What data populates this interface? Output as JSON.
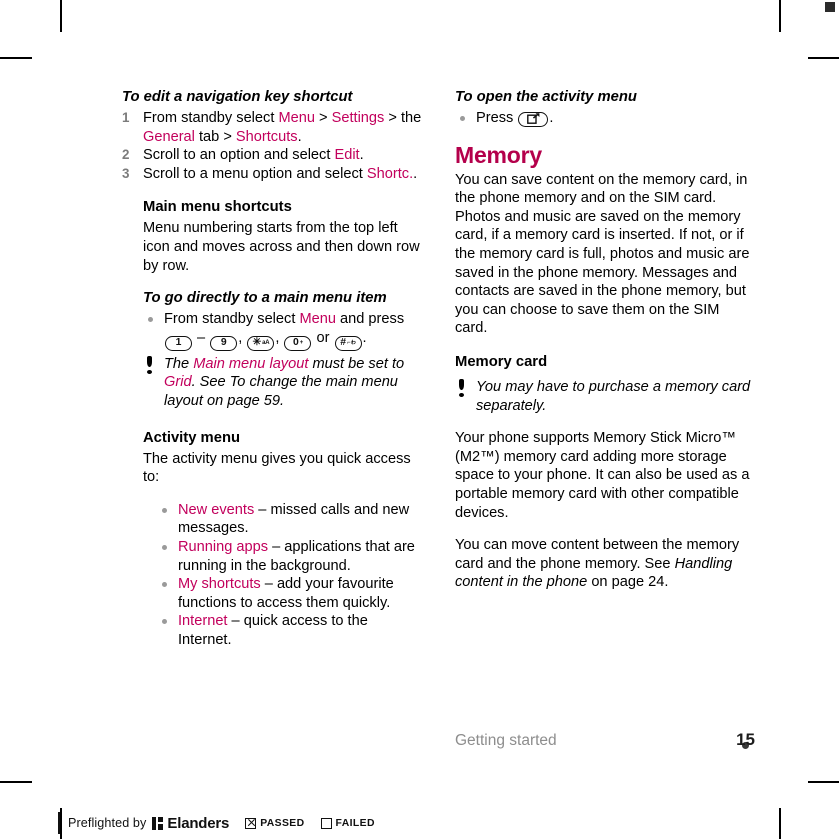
{
  "document": {
    "footer_section": "Getting started",
    "page_number": "15",
    "accent_color": "#c2005c",
    "heading_color": "#b4004b"
  },
  "left_column": {
    "procedure_1": {
      "heading": "To edit a navigation key shortcut",
      "steps": [
        {
          "parts": [
            {
              "t": "From standby select ",
              "s": "plain"
            },
            {
              "t": "Menu",
              "s": "ref"
            },
            {
              "t": " > ",
              "s": "plain"
            },
            {
              "t": "Settings",
              "s": "ref"
            },
            {
              "t": " > the ",
              "s": "plain"
            },
            {
              "t": "General",
              "s": "ref"
            },
            {
              "t": " tab > ",
              "s": "plain"
            },
            {
              "t": "Shortcuts",
              "s": "ref"
            },
            {
              "t": ".",
              "s": "plain"
            }
          ]
        },
        {
          "parts": [
            {
              "t": "Scroll to an option and select ",
              "s": "plain"
            },
            {
              "t": "Edit",
              "s": "ref"
            },
            {
              "t": ".",
              "s": "plain"
            }
          ]
        },
        {
          "parts": [
            {
              "t": "Scroll to a menu option and select ",
              "s": "plain"
            },
            {
              "t": "Shortc.",
              "s": "ref"
            },
            {
              "t": ".",
              "s": "plain"
            }
          ]
        }
      ]
    },
    "main_menu_shortcuts": {
      "heading": "Main menu shortcuts",
      "body": "Menu numbering starts from the top left icon and moves across and then down row by row."
    },
    "procedure_2": {
      "heading": "To go directly to a main menu item",
      "bullet_prefix": "From standby select ",
      "bullet_ref": "Menu",
      "bullet_mid": " and press ",
      "keys": [
        {
          "label": "1",
          "sup": ""
        },
        {
          "label": "9",
          "sup": ""
        },
        {
          "label": "✳",
          "sup": "aA"
        },
        {
          "label": "0",
          "sup": "+"
        },
        {
          "label": "#",
          "sup": "⌐ゎ"
        }
      ],
      "dash": " – ",
      "comma": ", ",
      "or": " or ",
      "period": "."
    },
    "note_1": {
      "parts": [
        {
          "t": "The ",
          "s": "ital"
        },
        {
          "t": "Main menu layout",
          "s": "refi"
        },
        {
          "t": " must be set to ",
          "s": "ital"
        },
        {
          "t": "Grid",
          "s": "refi"
        },
        {
          "t": ". See To change the main menu layout on page 59.",
          "s": "ital"
        }
      ]
    },
    "activity_menu": {
      "heading": "Activity menu",
      "body": "The activity menu gives you quick access to:",
      "items": [
        {
          "term": "New events",
          "desc": " – missed calls and new messages."
        },
        {
          "term": "Running apps",
          "desc": " – applications that are running in the background."
        },
        {
          "term": "My shortcuts",
          "desc": " – add your favourite functions to access them quickly."
        },
        {
          "term": "Internet",
          "desc": " – quick access to the Internet."
        }
      ]
    }
  },
  "right_column": {
    "procedure_3": {
      "heading": "To open the activity menu",
      "press_label": "Press ",
      "key_icon": "activity-menu-key",
      "period": "."
    },
    "memory": {
      "heading": "Memory",
      "body": "You can save content on the memory card, in the phone memory and on the SIM card. Photos and music are saved on the memory card, if a memory card is inserted. If not, or if the memory card is full, photos and music are saved in the phone memory. Messages and contacts are saved in the phone memory, but you can choose to save them on the SIM card."
    },
    "memory_card": {
      "heading": "Memory card",
      "note": "You may have to purchase a memory card separately.",
      "body_1": "Your phone supports Memory Stick Micro™ (M2™) memory card adding more storage space to your phone. It can also be used as a portable memory card with other compatible devices.",
      "body_2_parts": [
        {
          "t": "You can move content between the memory card and the phone memory. See ",
          "s": "plain"
        },
        {
          "t": "Handling content in the phone",
          "s": "ital"
        },
        {
          "t": " on page 24.",
          "s": "plain"
        }
      ]
    }
  },
  "preflight": {
    "label": "Preflighted by",
    "brand": "Elanders",
    "passed": "PASSED",
    "failed": "FAILED",
    "passed_checked": true,
    "failed_checked": false
  }
}
